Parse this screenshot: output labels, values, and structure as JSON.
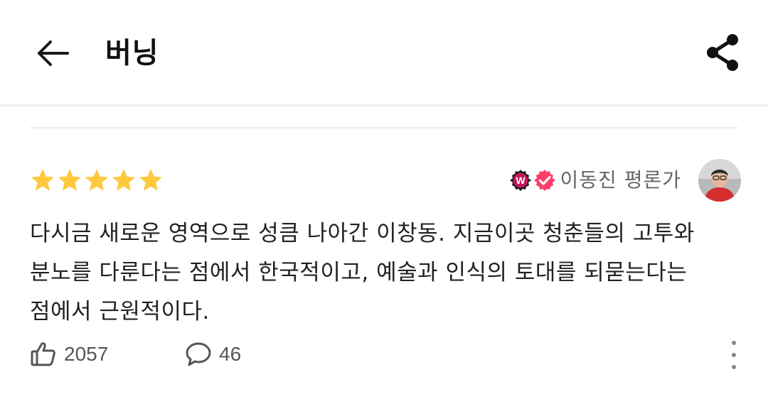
{
  "header": {
    "title": "버닝"
  },
  "review": {
    "rating": 5,
    "rating_max": 5,
    "reviewer_name": "이동진 평론가",
    "badges": [
      "w-badge-icon",
      "verified-check-icon"
    ],
    "text": "다시금 새로운 영역으로 성큼 나아간 이창동. 지금이곳 청춘들의 고투와 분노를 다룬다는 점에서 한국적이고, 예술과 인식의 토대를 되묻는다는 점에서 근원적이다.",
    "likes": "2057",
    "comments": "46"
  },
  "colors": {
    "star": "#FFC83D",
    "badge_w": "#C2185B",
    "badge_check": "#FF3E6C",
    "text": "#222222",
    "muted": "#666666"
  },
  "icons": {
    "back": "back-arrow-icon",
    "share": "share-icon",
    "like": "thumbs-up-icon",
    "comment": "comment-bubble-icon",
    "more": "more-vertical-icon"
  }
}
